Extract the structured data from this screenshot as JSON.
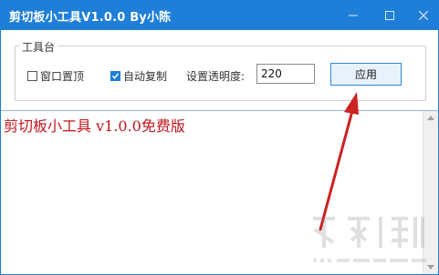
{
  "window": {
    "title": "剪切板小工具V1.0.0  By小陈",
    "controls": {
      "minimize": "minimize-icon",
      "maximize": "maximize-icon",
      "close": "close-icon"
    },
    "accent": "#1f7fd8"
  },
  "toolbox": {
    "group_label": "工具台",
    "pin_window_label": "窗口置顶",
    "pin_window_checked": false,
    "auto_copy_label": "自动复制",
    "auto_copy_checked": true,
    "opacity_label": "设置透明度:",
    "opacity_value": "220",
    "apply_label": "应用"
  },
  "editor": {
    "content": "剪切板小工具 v1.0.0免费版",
    "text_color": "#c0161c"
  },
  "annotation": {
    "arrow_color": "#cc2222"
  },
  "watermark": {
    "label": "下载吧",
    "site": "www.xiazaiba.com"
  }
}
